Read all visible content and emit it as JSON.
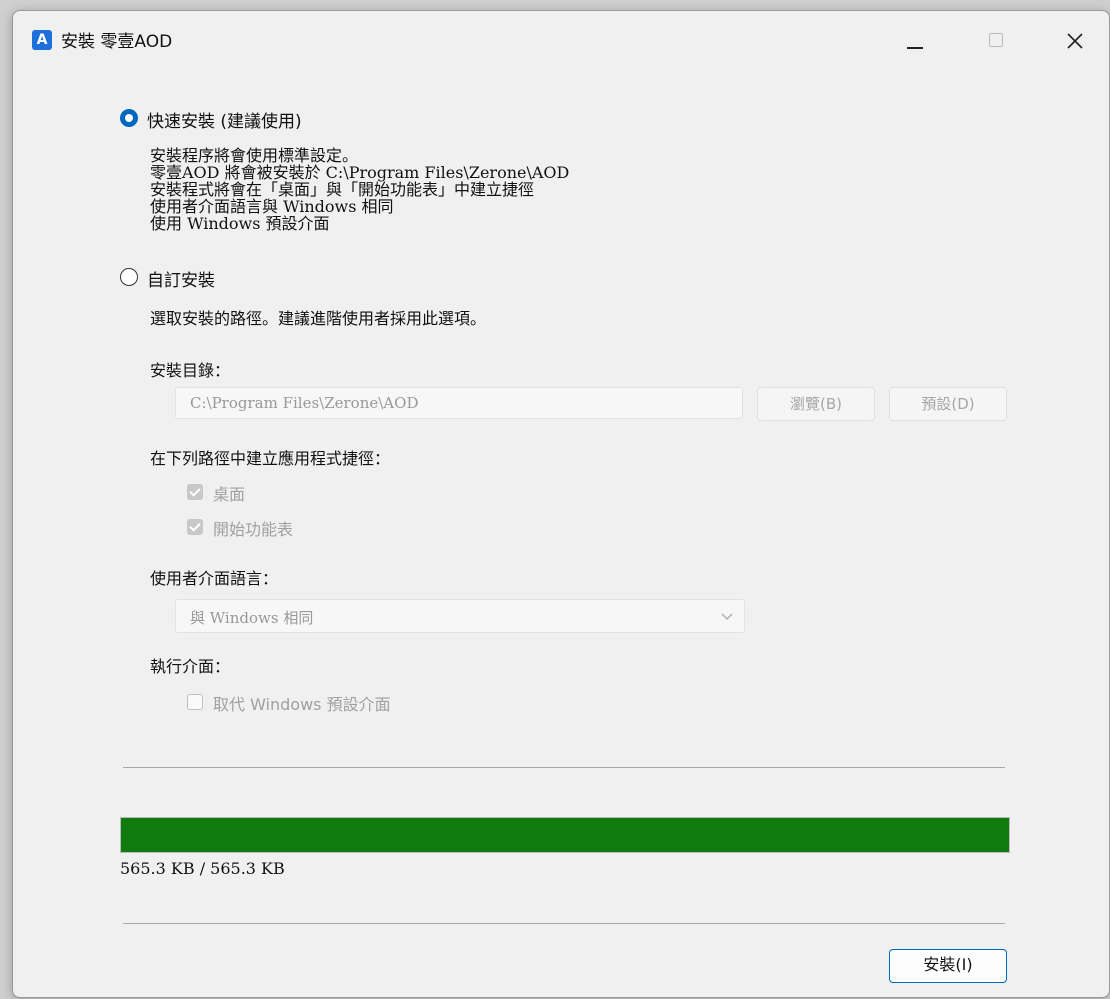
{
  "window": {
    "title": "安裝 零壹AOD",
    "icon": "app-logo-icon"
  },
  "quick_install": {
    "label": "快速安裝 (建議使用)",
    "selected": true,
    "lines": [
      "安裝程序將會使用標準設定。",
      "零壹AOD 將會被安裝於 C:\\Program Files\\Zerone\\AOD",
      "安裝程式將會在「桌面」與「開始功能表」中建立捷徑",
      "使用者介面語言與 Windows 相同",
      "使用 Windows 預設介面"
    ]
  },
  "custom_install": {
    "label": "自訂安裝",
    "selected": false,
    "description": "選取安裝的路徑。建議進階使用者採用此選項。",
    "dir_label": "安裝目錄：",
    "dir_value": "C:\\Program Files\\Zerone\\AOD",
    "browse_label": "瀏覽(B)",
    "default_label": "預設(D)",
    "shortcut_label": "在下列路徑中建立應用程式捷徑：",
    "shortcut_desktop": "桌面",
    "shortcut_start": "開始功能表",
    "lang_label": "使用者介面語言：",
    "lang_value": "與 Windows 相同",
    "exec_label": "執行介面：",
    "replace_label": "取代 Windows 預設介面"
  },
  "progress": {
    "percent": 100,
    "text": "565.3 KB / 565.3 KB",
    "color": "#0f7b0f"
  },
  "install_button": "安裝(I)"
}
